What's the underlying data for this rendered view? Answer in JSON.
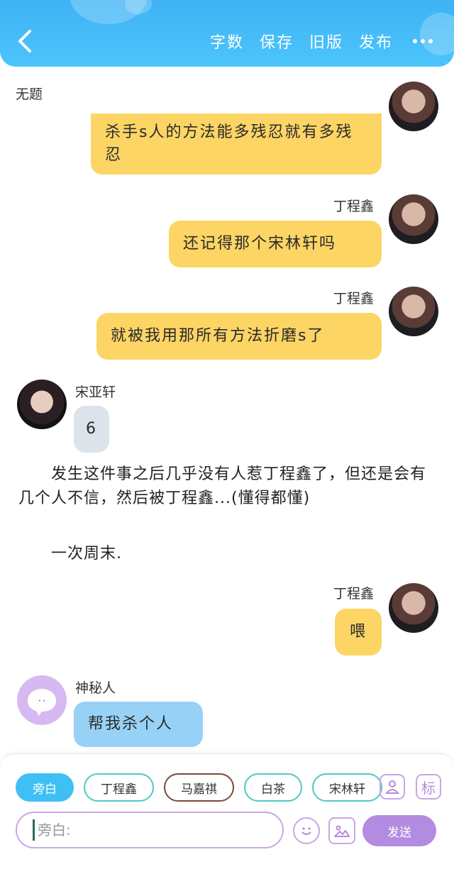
{
  "header": {
    "actions": [
      "字数",
      "保存",
      "旧版",
      "发布"
    ]
  },
  "doc_title": "无题",
  "messages": [
    {
      "side": "right",
      "color": "yellow",
      "text": "杀手s人的方法能多残忍就有多残忍"
    },
    {
      "side": "right",
      "color": "yellow",
      "name": "丁程鑫",
      "text": "还记得那个宋林轩吗"
    },
    {
      "side": "right",
      "color": "yellow",
      "name": "丁程鑫",
      "text": "就被我用那所有方法折磨s了"
    },
    {
      "side": "left",
      "color": "gray",
      "name": "宋亚轩",
      "text": "6"
    },
    {
      "side": "right",
      "color": "yellow",
      "name": "丁程鑫",
      "text": "喂"
    },
    {
      "side": "left",
      "color": "blue",
      "name": "神秘人",
      "text": "帮我杀个人"
    }
  ],
  "narration": [
    "发生这件事之后几乎没有人惹丁程鑫了，但还是会有几个人不信，然后被丁程鑫...(懂得都懂)",
    "一次周末."
  ],
  "composer": {
    "chips": [
      "旁白",
      "丁程鑫",
      "马嘉祺",
      "白茶",
      "宋林轩"
    ],
    "label_button": "标",
    "placeholder": "旁白:",
    "send_label": "发送"
  },
  "colors": {
    "header": "#3fb3f5",
    "bubble_yellow": "#fcd565",
    "bubble_gray": "#dde3eb",
    "bubble_blue": "#97d2f6",
    "accent_purple": "#b38be0"
  }
}
